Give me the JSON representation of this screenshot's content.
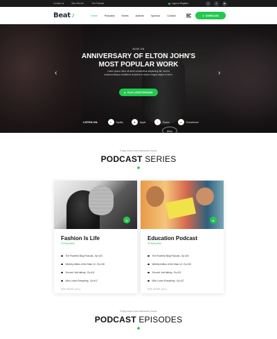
{
  "topbar": {
    "links": [
      "Contact us",
      "Who We Are",
      "The Podcast"
    ],
    "login": "Login or Register",
    "social": [
      {
        "name": "facebook-icon",
        "glyph": "f"
      },
      {
        "name": "twitter-icon",
        "glyph": "t"
      },
      {
        "name": "youtube-icon",
        "glyph": "▶"
      }
    ]
  },
  "header": {
    "logo_text": "Beat",
    "nav": [
      {
        "label": "Home",
        "active": true
      },
      {
        "label": "Podcasts",
        "active": false
      },
      {
        "label": "Series",
        "active": false
      },
      {
        "label": "Authors",
        "active": false
      },
      {
        "label": "Sponsor",
        "active": false
      },
      {
        "label": "Contact",
        "active": false
      }
    ],
    "download_label": "DOWNLOAD",
    "accent": "#23c94f"
  },
  "hero": {
    "kicker": "NOW ON",
    "title_line1": "ANNIVERSARY OF ELTON JOHN'S",
    "title_line2": "MOST POPULAR WORK",
    "description": "Lorem ipsum dolor sit amet consectetur adipiscing elit, sed do eiusmod tempor incididunt ut labore et dolore magna aliqua ut enim.",
    "play_label": "PLAY LATEST EPISODE",
    "listen_label": "LISTEN ON:",
    "platforms": [
      "Spotify",
      "Apple",
      "iTunes",
      "Soundcloud"
    ],
    "mic_brand": "Blue"
  },
  "series_section": {
    "kicker": "Enjoy some new awesome music",
    "title_bold": "PODCAST",
    "title_thin": " SERIES"
  },
  "cards": [
    {
      "title": "Fashion Is Life",
      "episodes": "33 Episodes",
      "items": [
        "The Powerful Blog Podcast - Ep #20",
        "Weekly edition of the Mum Ut - Ep #18",
        "Jim and Jodi talking - Ep #11",
        "Who Loves Everything - Ep #17"
      ],
      "see_label": "SEE MORE (ALL)"
    },
    {
      "title": "Education Podcast",
      "episodes": "33 Episodes",
      "items": [
        "The Powerful Blog Podcast - Ep #20",
        "Weekly edition of the Mum Ut - Ep #18",
        "Jim and Jodi talking - Ep #11",
        "Who Loves Everything - Ep #17"
      ],
      "see_label": "SEE MORE (ALL)"
    }
  ],
  "episodes_section": {
    "kicker": "Enjoy some new awesome music",
    "title_bold": "PODCAST",
    "title_thin": " EPISODES"
  }
}
